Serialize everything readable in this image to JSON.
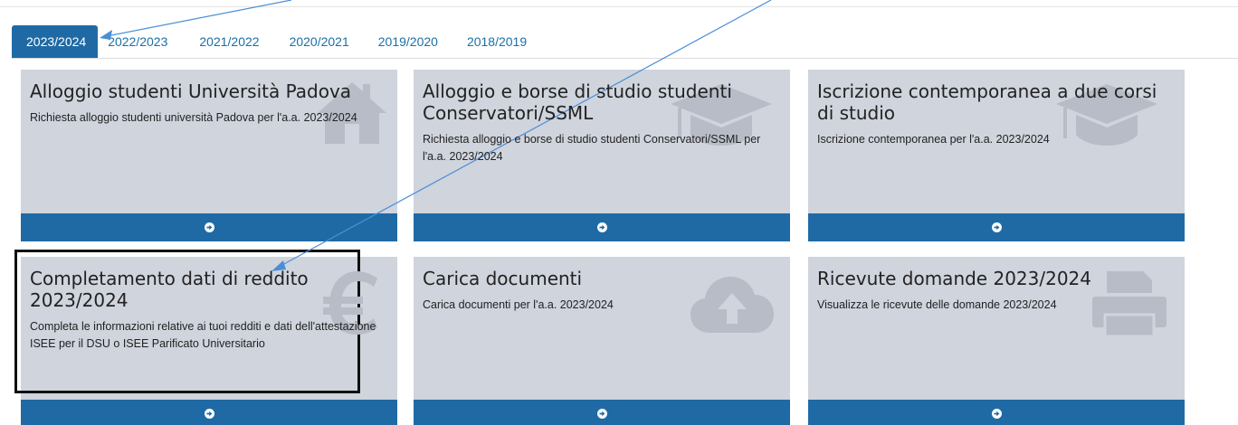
{
  "tabs": [
    {
      "label": "2023/2024",
      "active": true
    },
    {
      "label": "2022/2023",
      "active": false
    },
    {
      "label": "2021/2022",
      "active": false
    },
    {
      "label": "2020/2021",
      "active": false
    },
    {
      "label": "2019/2020",
      "active": false
    },
    {
      "label": "2018/2019",
      "active": false
    }
  ],
  "tiles": [
    {
      "title": "Alloggio studenti Università Padova",
      "description": "Richiesta alloggio studenti università Padova per l'a.a. 2023/2024",
      "icon": "home-icon"
    },
    {
      "title": "Alloggio e borse di studio studenti Conservatori/SSML",
      "description": "Richiesta alloggio e borse di studio studenti Conservatori/SSML per l'a.a. 2023/2024",
      "icon": "graduation-cap-icon"
    },
    {
      "title": "Iscrizione contemporanea a due corsi di studio",
      "description": "Iscrizione contemporanea per l'a.a. 2023/2024",
      "icon": "graduation-cap-icon"
    },
    {
      "title": "Completamento dati di reddito 2023/2024",
      "description": "Completa le informazioni relative ai tuoi redditi e dati dell'attestazione ISEE per il DSU o ISEE Parificato Universitario",
      "icon": "euro-icon"
    },
    {
      "title": "Carica documenti",
      "description": "Carica documenti per l'a.a. 2023/2024",
      "icon": "cloud-upload-icon"
    },
    {
      "title": "Ricevute domande 2023/2024",
      "description": "Visualizza le ricevute delle domande 2023/2024",
      "icon": "printer-icon"
    }
  ],
  "colors": {
    "accent": "#1f6aa5",
    "tile_background": "#cfd4dd",
    "icon_watermark": "#b7bcc6",
    "annotation": "#4a8fd6",
    "highlight": "#111111"
  }
}
